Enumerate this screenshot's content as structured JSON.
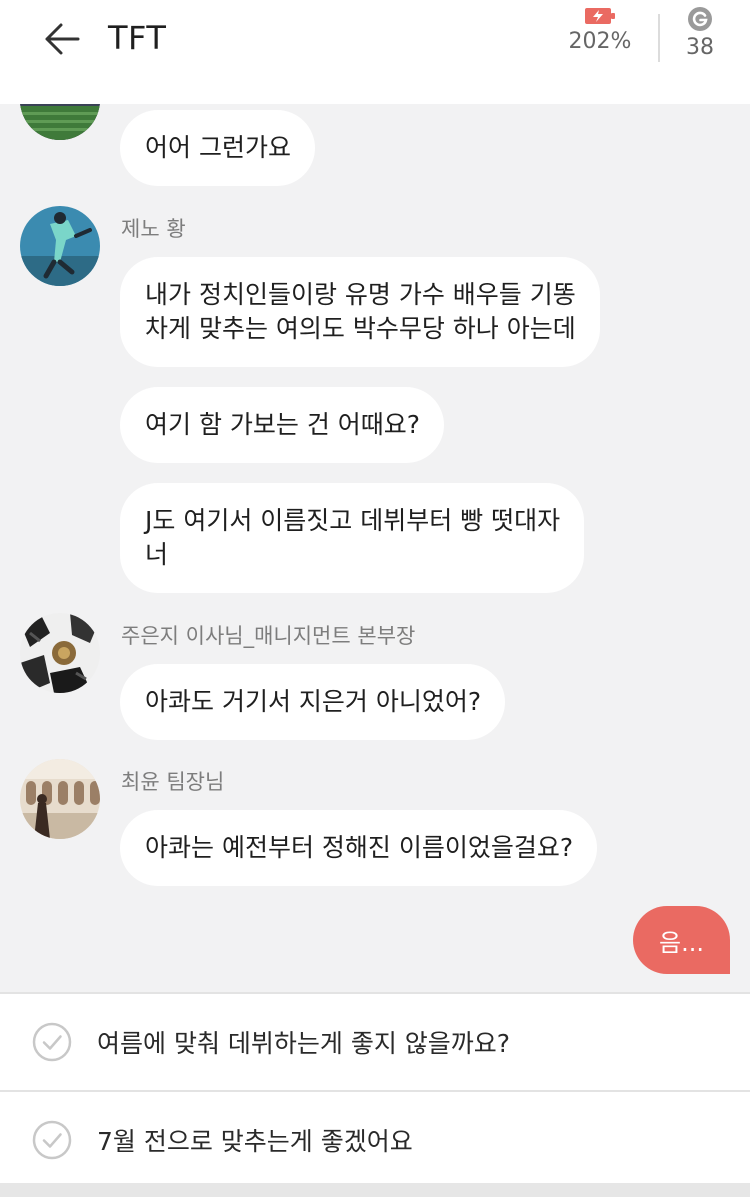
{
  "header": {
    "title": "TFT",
    "battery_value": "202%",
    "coin_value": "38",
    "accent": "#ea6a62"
  },
  "messages": [
    {
      "sender": "",
      "text": "어어 그런가요"
    },
    {
      "sender": "제노 황",
      "text": "내가 정치인들이랑 유명 가수 배우들 기똥\n차게 맞추는 여의도 박수무당 하나 아는데"
    },
    {
      "sender": "",
      "text": "여기 함 가보는 건 어때요?"
    },
    {
      "sender": "",
      "text": "J도 여기서 이름짓고 데뷔부터 빵 떳대자\n너"
    },
    {
      "sender": "주은지 이사님_매니지먼트 본부장",
      "text": "아콰도 거기서 지은거 아니었어?"
    },
    {
      "sender": "최윤 팀장님",
      "text": "아콰는 예전부터 정해진 이름이었을걸요?"
    }
  ],
  "outgoing": {
    "text": "음..."
  },
  "choices": [
    {
      "label": "여름에 맞춰 데뷔하는게 좋지 않을까요?"
    },
    {
      "label": "7월 전으로 맞추는게 좋겠어요"
    }
  ],
  "icons": {
    "back": "arrow-left-icon",
    "battery": "battery-charging-icon",
    "coin": "g-coin-icon",
    "check": "check-circle-icon"
  }
}
